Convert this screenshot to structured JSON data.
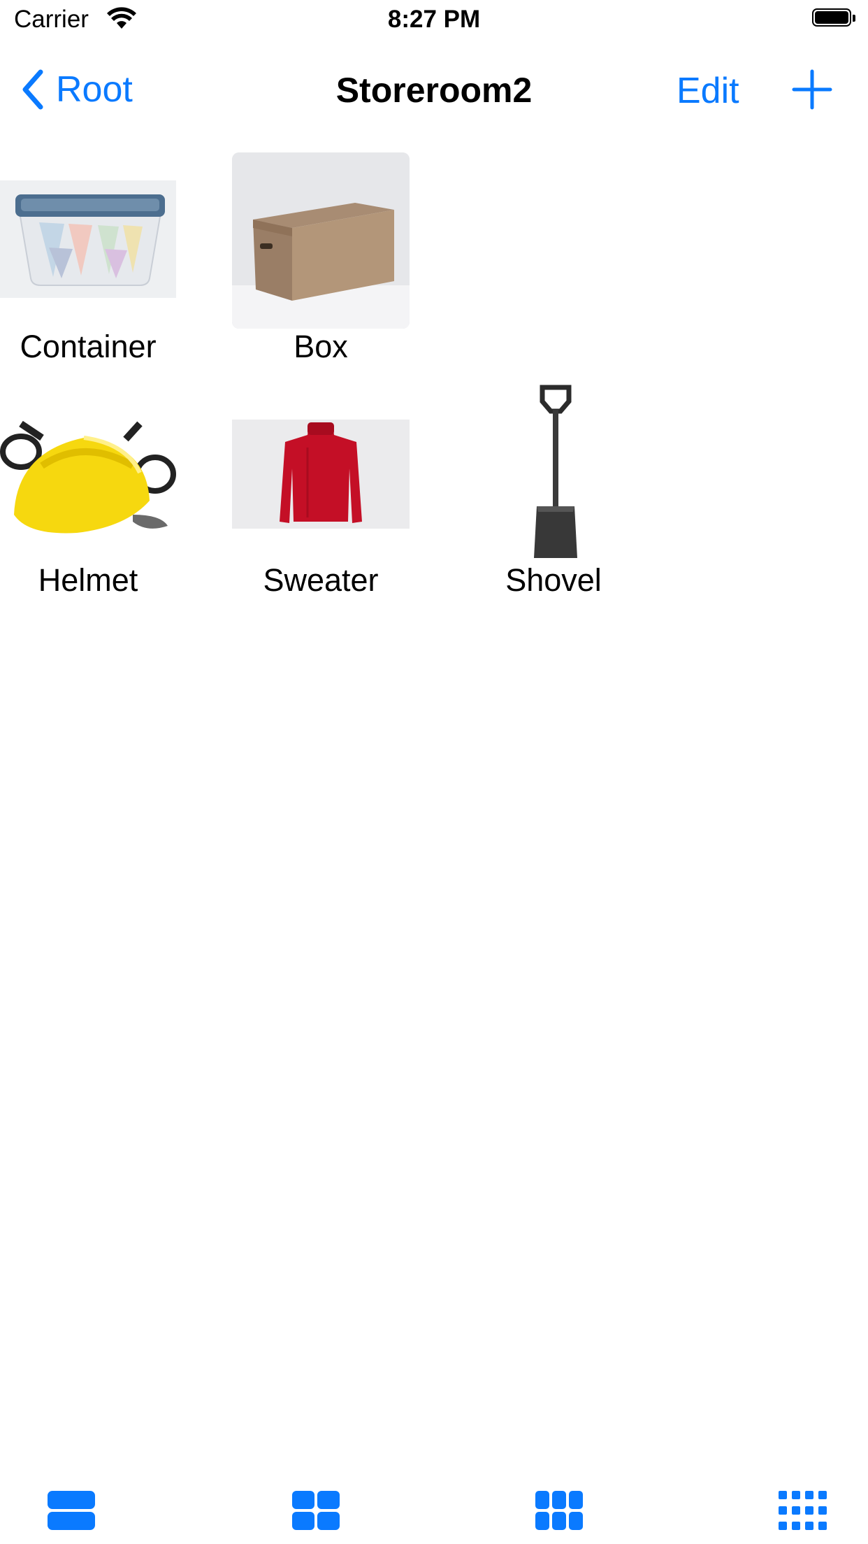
{
  "status_bar": {
    "carrier": "Carrier",
    "time": "8:27 PM"
  },
  "nav": {
    "back_label": "Root",
    "title": "Storeroom2",
    "edit_label": "Edit"
  },
  "items": [
    {
      "name": "Container",
      "icon": "plastic-container-photo"
    },
    {
      "name": "Box",
      "icon": "cardboard-box-photo"
    },
    {
      "name": "Helmet",
      "icon": "yellow-helmet-photo"
    },
    {
      "name": "Sweater",
      "icon": "red-sweater-photo"
    },
    {
      "name": "Shovel",
      "icon": "shovel-photo"
    }
  ],
  "tab_bar": {
    "tabs": [
      {
        "icon": "one-column-layout-icon"
      },
      {
        "icon": "two-column-layout-icon"
      },
      {
        "icon": "three-column-layout-icon"
      },
      {
        "icon": "four-column-layout-icon"
      }
    ]
  },
  "colors": {
    "accent": "#0a7aff"
  }
}
